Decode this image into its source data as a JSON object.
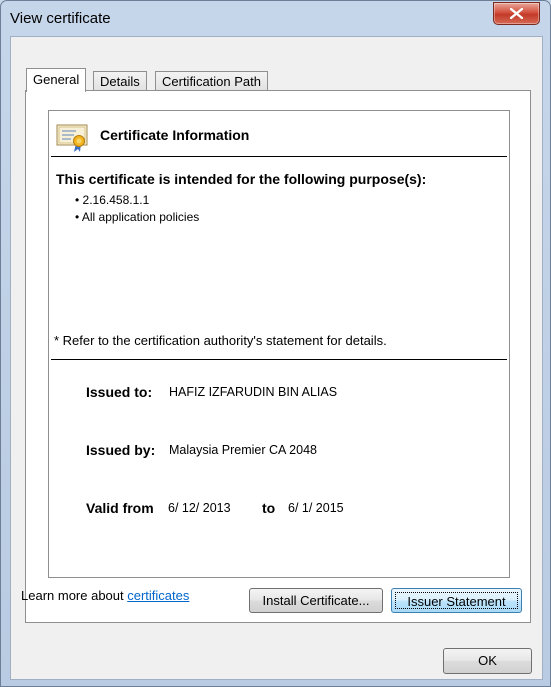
{
  "window": {
    "title": "View certificate",
    "close_icon": "close-icon"
  },
  "tabs": [
    {
      "label": "General",
      "active": true
    },
    {
      "label": "Details",
      "active": false
    },
    {
      "label": "Certification Path",
      "active": false
    }
  ],
  "info": {
    "icon": "certificate-icon",
    "title": "Certificate Information",
    "purpose_heading": "This certificate is intended for the following purpose(s):",
    "purposes": [
      "2.16.458.1.1",
      "All application policies"
    ],
    "refer_note": "* Refer to the certification authority's statement for details.",
    "issued_to_label": "Issued to:",
    "issued_to_value": "HAFIZ IZFARUDIN BIN ALIAS",
    "issued_by_label": "Issued by:",
    "issued_by_value": "Malaysia Premier CA 2048",
    "valid_from_label": "Valid from",
    "valid_from_value": "6/ 12/ 2013",
    "valid_to_label": "to",
    "valid_to_value": "6/ 1/ 2015"
  },
  "buttons": {
    "install": "Install Certificate...",
    "issuer_statement": "Issuer Statement",
    "ok": "OK"
  },
  "learn_more": {
    "prefix": "Learn more about ",
    "link": "certificates"
  }
}
